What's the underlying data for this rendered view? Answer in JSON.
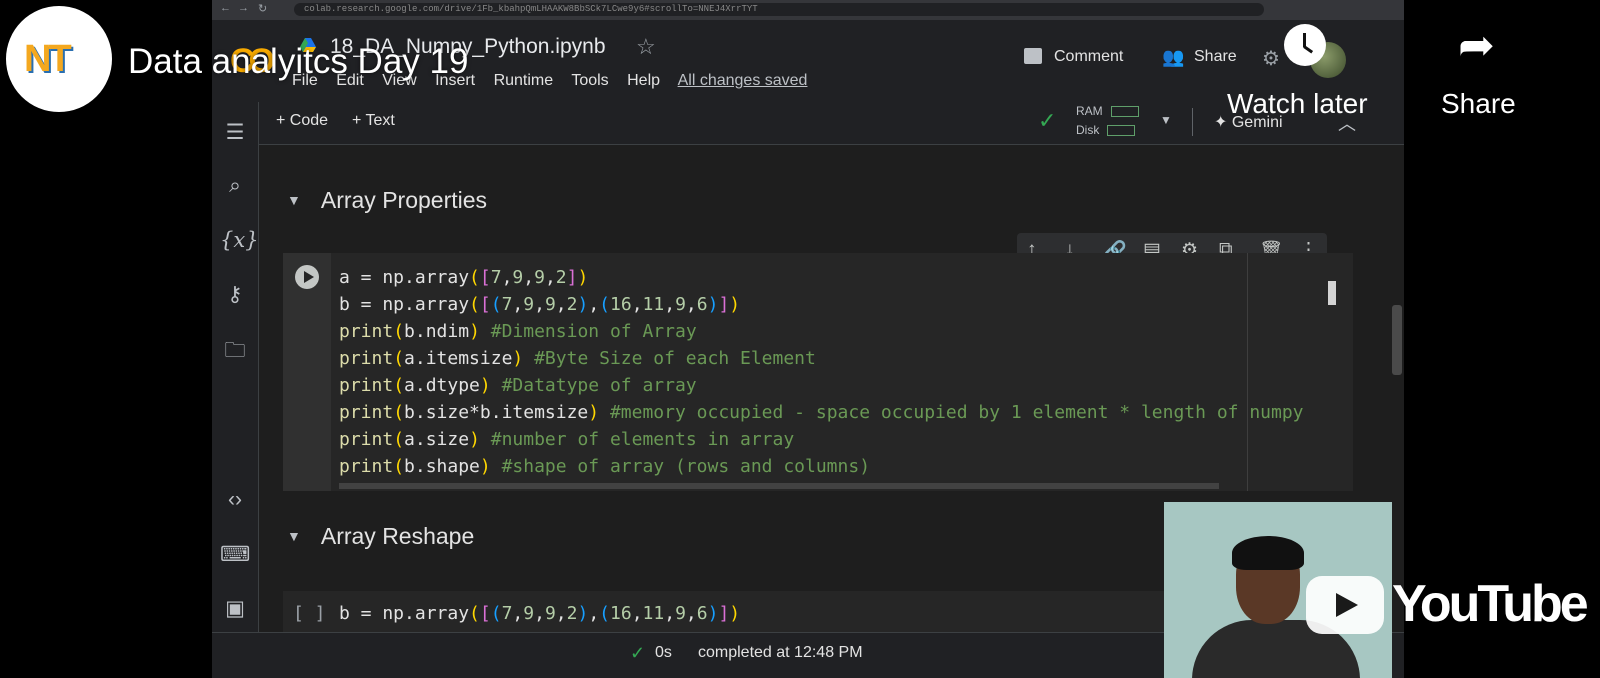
{
  "browser": {
    "url": "colab.research.google.com/drive/1Fb_kbahpQmLHAAKW8BbSCk7LCwe9y6#scrollTo=NNEJ4XrrTYT"
  },
  "channel": {
    "logo_text": "NT"
  },
  "video": {
    "title": "Data analyitcs Day 19"
  },
  "overlay": {
    "watch_later": "Watch later",
    "share": "Share",
    "youtube": "YouTube"
  },
  "colab": {
    "notebook_title": "18_DA_Numpy_Python.ipynb",
    "menu": [
      "File",
      "Edit",
      "View",
      "Insert",
      "Runtime",
      "Tools",
      "Help"
    ],
    "saved_status": "All changes saved",
    "comment_label": "Comment",
    "share_label": "Share",
    "toolbar": {
      "add_code": "+ Code",
      "add_text": "+ Text",
      "ram": "RAM",
      "disk": "Disk",
      "gemini": "Gemini"
    },
    "sections": [
      {
        "title": "Array Properties"
      },
      {
        "title": "Array Reshape"
      }
    ],
    "cell1_lines": [
      "a = np.array([7,9,9,2])",
      "b = np.array([(7,9,9,2),(16,11,9,6)])",
      "print(b.ndim) #Dimension of Array",
      "print(a.itemsize) #Byte Size of each Element",
      "print(a.dtype) #Datatype of array",
      "print(b.size*b.itemsize) #memory occupied - space occupied by 1 element * length of numpy",
      "print(a.size) #number of elements in array",
      "print(b.shape) #shape of array (rows and columns)"
    ],
    "cell2": {
      "prompt": "[ ]",
      "line": "b = np.array([(7,9,9,2),(16,11,9,6)])"
    },
    "status": {
      "time": "0s",
      "text": "completed at 12:48 PM"
    }
  },
  "colors": {
    "accent_green": "#34a853",
    "colab_orange": "#f9ab00",
    "bg": "#202124"
  }
}
